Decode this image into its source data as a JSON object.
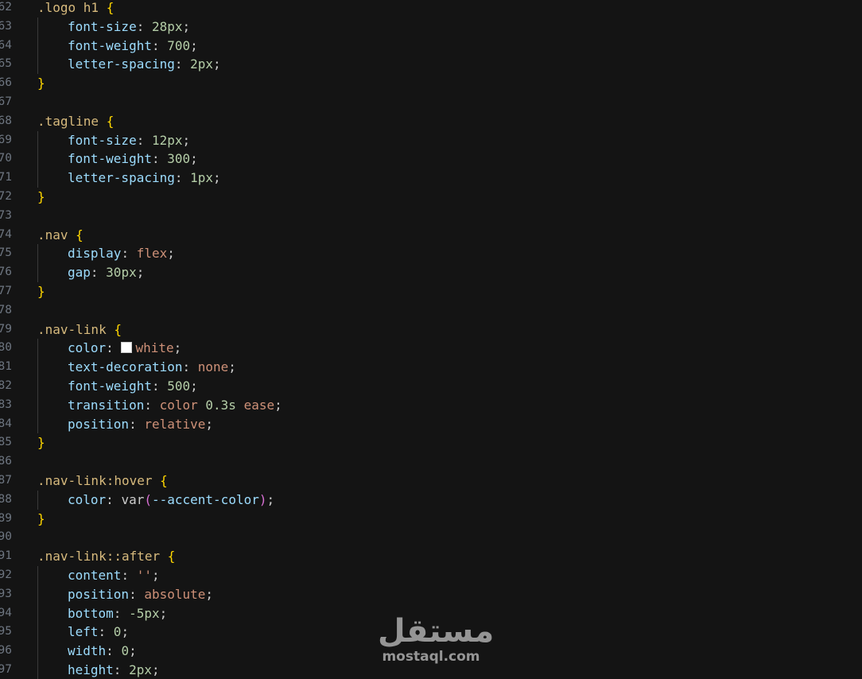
{
  "editor": {
    "lines": [
      {
        "n": "62",
        "tokens": [
          [
            "sel",
            ".logo h1 "
          ],
          [
            "brace",
            "{"
          ]
        ]
      },
      {
        "n": "63",
        "tokens": [
          [
            "prop",
            "font-size"
          ],
          [
            "punc",
            ": "
          ],
          [
            "num",
            "28px"
          ],
          [
            "punc",
            ";"
          ]
        ]
      },
      {
        "n": "64",
        "tokens": [
          [
            "prop",
            "font-weight"
          ],
          [
            "punc",
            ": "
          ],
          [
            "num",
            "700"
          ],
          [
            "punc",
            ";"
          ]
        ]
      },
      {
        "n": "65",
        "tokens": [
          [
            "prop",
            "letter-spacing"
          ],
          [
            "punc",
            ": "
          ],
          [
            "num",
            "2px"
          ],
          [
            "punc",
            ";"
          ]
        ]
      },
      {
        "n": "66",
        "tokens": [
          [
            "brace",
            "}"
          ]
        ]
      },
      {
        "n": "67",
        "tokens": []
      },
      {
        "n": "68",
        "tokens": [
          [
            "sel",
            ".tagline "
          ],
          [
            "brace",
            "{"
          ]
        ]
      },
      {
        "n": "69",
        "tokens": [
          [
            "prop",
            "font-size"
          ],
          [
            "punc",
            ": "
          ],
          [
            "num",
            "12px"
          ],
          [
            "punc",
            ";"
          ]
        ]
      },
      {
        "n": "70",
        "tokens": [
          [
            "prop",
            "font-weight"
          ],
          [
            "punc",
            ": "
          ],
          [
            "num",
            "300"
          ],
          [
            "punc",
            ";"
          ]
        ]
      },
      {
        "n": "71",
        "tokens": [
          [
            "prop",
            "letter-spacing"
          ],
          [
            "punc",
            ": "
          ],
          [
            "num",
            "1px"
          ],
          [
            "punc",
            ";"
          ]
        ]
      },
      {
        "n": "72",
        "tokens": [
          [
            "brace",
            "}"
          ]
        ]
      },
      {
        "n": "73",
        "tokens": []
      },
      {
        "n": "74",
        "tokens": [
          [
            "sel",
            ".nav "
          ],
          [
            "brace",
            "{"
          ]
        ]
      },
      {
        "n": "75",
        "tokens": [
          [
            "prop",
            "display"
          ],
          [
            "punc",
            ": "
          ],
          [
            "kw",
            "flex"
          ],
          [
            "punc",
            ";"
          ]
        ]
      },
      {
        "n": "76",
        "tokens": [
          [
            "prop",
            "gap"
          ],
          [
            "punc",
            ": "
          ],
          [
            "num",
            "30px"
          ],
          [
            "punc",
            ";"
          ]
        ]
      },
      {
        "n": "77",
        "tokens": [
          [
            "brace",
            "}"
          ]
        ]
      },
      {
        "n": "78",
        "tokens": []
      },
      {
        "n": "79",
        "tokens": [
          [
            "sel",
            ".nav-link "
          ],
          [
            "brace",
            "{"
          ]
        ]
      },
      {
        "n": "80",
        "tokens": [
          [
            "prop",
            "color"
          ],
          [
            "punc",
            ": "
          ],
          [
            "swatch",
            ""
          ],
          [
            "kw",
            "white"
          ],
          [
            "punc",
            ";"
          ]
        ]
      },
      {
        "n": "81",
        "tokens": [
          [
            "prop",
            "text-decoration"
          ],
          [
            "punc",
            ": "
          ],
          [
            "kw",
            "none"
          ],
          [
            "punc",
            ";"
          ]
        ]
      },
      {
        "n": "82",
        "tokens": [
          [
            "prop",
            "font-weight"
          ],
          [
            "punc",
            ": "
          ],
          [
            "num",
            "500"
          ],
          [
            "punc",
            ";"
          ]
        ]
      },
      {
        "n": "83",
        "tokens": [
          [
            "prop",
            "transition"
          ],
          [
            "punc",
            ": "
          ],
          [
            "kw",
            "color"
          ],
          [
            "punc",
            " "
          ],
          [
            "num",
            "0.3s"
          ],
          [
            "punc",
            " "
          ],
          [
            "kw",
            "ease"
          ],
          [
            "punc",
            ";"
          ]
        ]
      },
      {
        "n": "84",
        "tokens": [
          [
            "prop",
            "position"
          ],
          [
            "punc",
            ": "
          ],
          [
            "kw",
            "relative"
          ],
          [
            "punc",
            ";"
          ]
        ]
      },
      {
        "n": "85",
        "tokens": [
          [
            "brace",
            "}"
          ]
        ]
      },
      {
        "n": "86",
        "tokens": []
      },
      {
        "n": "87",
        "tokens": [
          [
            "sel",
            ".nav-link:hover "
          ],
          [
            "brace",
            "{"
          ]
        ]
      },
      {
        "n": "88",
        "tokens": [
          [
            "prop",
            "color"
          ],
          [
            "punc",
            ": var"
          ],
          [
            "paren",
            "("
          ],
          [
            "var",
            "--accent-color"
          ],
          [
            "paren",
            ")"
          ],
          [
            "punc",
            ";"
          ]
        ]
      },
      {
        "n": "89",
        "tokens": [
          [
            "brace",
            "}"
          ]
        ]
      },
      {
        "n": "90",
        "tokens": []
      },
      {
        "n": "91",
        "tokens": [
          [
            "sel",
            ".nav-link::after "
          ],
          [
            "brace",
            "{"
          ]
        ]
      },
      {
        "n": "92",
        "tokens": [
          [
            "prop",
            "content"
          ],
          [
            "punc",
            ": "
          ],
          [
            "str",
            "''"
          ],
          [
            "punc",
            ";"
          ]
        ]
      },
      {
        "n": "93",
        "tokens": [
          [
            "prop",
            "position"
          ],
          [
            "punc",
            ": "
          ],
          [
            "kw",
            "absolute"
          ],
          [
            "punc",
            ";"
          ]
        ]
      },
      {
        "n": "94",
        "tokens": [
          [
            "prop",
            "bottom"
          ],
          [
            "punc",
            ": "
          ],
          [
            "num",
            "-5px"
          ],
          [
            "punc",
            ";"
          ]
        ]
      },
      {
        "n": "95",
        "tokens": [
          [
            "prop",
            "left"
          ],
          [
            "punc",
            ": "
          ],
          [
            "num",
            "0"
          ],
          [
            "punc",
            ";"
          ]
        ]
      },
      {
        "n": "96",
        "tokens": [
          [
            "prop",
            "width"
          ],
          [
            "punc",
            ": "
          ],
          [
            "num",
            "0"
          ],
          [
            "punc",
            ";"
          ]
        ]
      },
      {
        "n": "97",
        "tokens": [
          [
            "prop",
            "height"
          ],
          [
            "punc",
            ": "
          ],
          [
            "num",
            "2px"
          ],
          [
            "punc",
            ";"
          ]
        ]
      }
    ]
  },
  "watermark": {
    "logo": "مستقل",
    "url": "mostaql.com"
  },
  "colors": {
    "background": "#141414",
    "selector": "#d7ba7d",
    "brace": "#ffd700",
    "property": "#9cdcfe",
    "number": "#b5cea8",
    "keyword": "#ce9178"
  }
}
